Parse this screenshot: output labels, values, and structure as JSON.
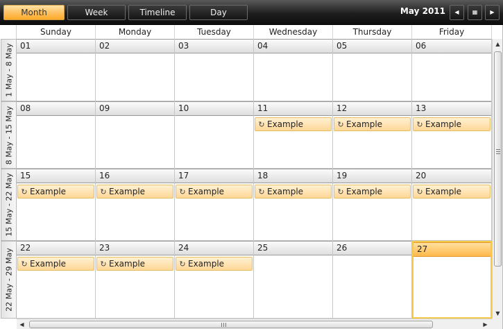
{
  "toolbar": {
    "views": [
      {
        "label": "Month",
        "active": true
      },
      {
        "label": "Week",
        "active": false
      },
      {
        "label": "Timeline",
        "active": false
      },
      {
        "label": "Day",
        "active": false
      }
    ],
    "period_label": "May 2011",
    "prev_icon": "triangle-left-icon",
    "calendar_icon": "calendar-grid-icon",
    "next_icon": "triangle-right-icon"
  },
  "day_headers": [
    "Sunday",
    "Monday",
    "Tuesday",
    "Wednesday",
    "Thursday",
    "Friday"
  ],
  "weeks": [
    {
      "label": "1 May - 8 May",
      "days": [
        {
          "num": "01",
          "appts": []
        },
        {
          "num": "02",
          "appts": []
        },
        {
          "num": "03",
          "appts": []
        },
        {
          "num": "04",
          "appts": []
        },
        {
          "num": "05",
          "appts": []
        },
        {
          "num": "06",
          "appts": []
        }
      ]
    },
    {
      "label": "8 May - 15 May",
      "days": [
        {
          "num": "08",
          "appts": []
        },
        {
          "num": "09",
          "appts": []
        },
        {
          "num": "10",
          "appts": []
        },
        {
          "num": "11",
          "appts": [
            "Example"
          ]
        },
        {
          "num": "12",
          "appts": [
            "Example"
          ]
        },
        {
          "num": "13",
          "appts": [
            "Example"
          ]
        }
      ]
    },
    {
      "label": "15 May - 22 May",
      "days": [
        {
          "num": "15",
          "appts": [
            "Example"
          ]
        },
        {
          "num": "16",
          "appts": [
            "Example"
          ]
        },
        {
          "num": "17",
          "appts": [
            "Example"
          ]
        },
        {
          "num": "18",
          "appts": [
            "Example"
          ]
        },
        {
          "num": "19",
          "appts": [
            "Example"
          ]
        },
        {
          "num": "20",
          "appts": [
            "Example"
          ]
        }
      ]
    },
    {
      "label": "22 May - 29 May",
      "days": [
        {
          "num": "22",
          "appts": [
            "Example"
          ]
        },
        {
          "num": "23",
          "appts": [
            "Example"
          ]
        },
        {
          "num": "24",
          "appts": [
            "Example"
          ]
        },
        {
          "num": "25",
          "appts": []
        },
        {
          "num": "26",
          "appts": []
        },
        {
          "num": "27",
          "appts": [],
          "today": true
        }
      ]
    }
  ],
  "appointment_icon": "recurrence-icon",
  "colors": {
    "active_view": "#ffc264",
    "appointment_fill": "#ffd797",
    "today_border": "#f7c94a",
    "toolbar_bg": "#1e1e1e"
  }
}
